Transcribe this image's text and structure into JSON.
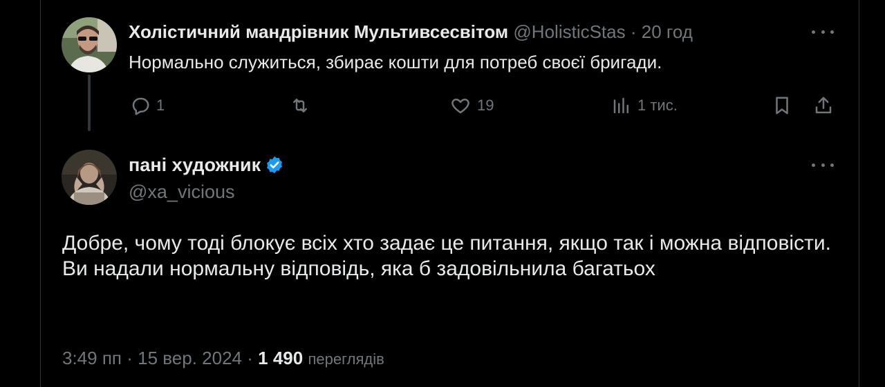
{
  "reply": {
    "author_name": "Холістичний мандрівник Мультивсесвітом",
    "author_handle": "@HolisticStas",
    "separator": "·",
    "time": "20 год",
    "text": "Нормально служиться, збирає кошти для потреб своєї бригади.",
    "actions": {
      "replies": "1",
      "reposts": "",
      "likes": "19",
      "views": "1 тис."
    },
    "icons": [
      "reply-icon",
      "repost-icon",
      "like-icon",
      "views-icon",
      "bookmark-icon",
      "share-icon",
      "more-icon"
    ]
  },
  "main_tweet": {
    "author_name": "пані художник",
    "verified_color": "#1d9bf0",
    "author_handle": "@xa_vicious",
    "text_lines": [
      "Добре, чому тоді блокує всіх хто задає це питання, якщо так і можна відповісти.",
      "Ви надали нормальну відповідь, яка б задовільнила багатьох"
    ],
    "meta": {
      "time": "3:49 пп",
      "separator1": "·",
      "date": "15 вер. 2024",
      "separator2": "·",
      "views_count": "1 490",
      "views_label": "переглядів"
    }
  },
  "colors": {
    "background": "#000000",
    "text_primary": "#e7e9ea",
    "text_secondary": "#71767b",
    "border": "#2f3336",
    "accent": "#1d9bf0"
  }
}
